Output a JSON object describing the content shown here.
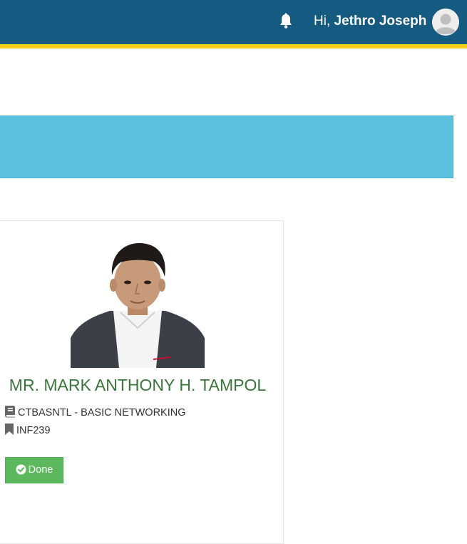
{
  "header": {
    "greeting_prefix": "Hi,",
    "user_name": "Jethro Joseph",
    "bar_color": "#155a80",
    "stripe_color": "#f5cf18",
    "icons": [
      "bell-icon",
      "user-avatar-icon"
    ]
  },
  "banner": {
    "color": "#5bc0de"
  },
  "teacher_card": {
    "name": "MR. MARK ANTHONY H. TAMPOL",
    "subject": "CTBASNTL - BASIC NETWORKING",
    "section": "INF239",
    "subject_icon": "book-icon",
    "section_icon": "bookmark-icon",
    "status_button": {
      "label": "Done",
      "icon": "check-circle-icon",
      "color": "#5cb85c"
    }
  }
}
